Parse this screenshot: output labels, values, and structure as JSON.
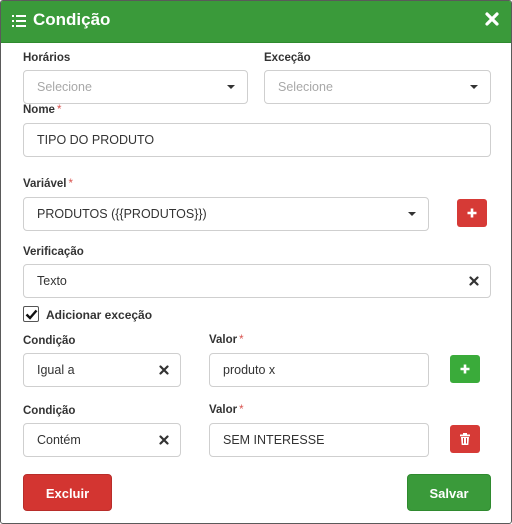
{
  "header": {
    "title": "Condição",
    "menu_icon": "list-icon",
    "close_icon": "close-icon",
    "color": "#3a9a3a"
  },
  "horarios": {
    "label": "Horários",
    "placeholder": "Selecione"
  },
  "excecao": {
    "label": "Exceção",
    "placeholder": "Selecione"
  },
  "nome": {
    "label": "Nome",
    "required_mark": "*",
    "value": "TIPO DO PRODUTO"
  },
  "variavel": {
    "label": "Variável",
    "required_mark": "*",
    "value": "PRODUTOS ({{PRODUTOS}})"
  },
  "verificacao": {
    "label": "Verificação",
    "value": "Texto"
  },
  "adicionar_excecao": {
    "label": "Adicionar exceção",
    "checked": true
  },
  "rules": [
    {
      "condicao_label": "Condição",
      "condicao_value": "Igual a",
      "valor_label": "Valor",
      "required_mark": "*",
      "valor_value": "produto x",
      "action": "add"
    },
    {
      "condicao_label": "Condição",
      "condicao_value": "Contém",
      "valor_label": "Valor",
      "required_mark": "*",
      "valor_value": "SEM INTERESSE",
      "action": "delete"
    }
  ],
  "footer": {
    "excluir_label": "Excluir",
    "salvar_label": "Salvar",
    "danger_color": "#d33531",
    "success_color": "#3a9a3a"
  }
}
